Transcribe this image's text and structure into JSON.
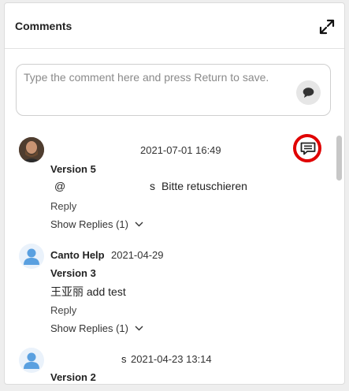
{
  "header": {
    "title": "Comments"
  },
  "composer": {
    "placeholder": "Type the comment here and press Return to save."
  },
  "comments": [
    {
      "date": "2021-07-01 16:49",
      "version": "Version 5",
      "mention_prefix": "@",
      "mention_suffix": "s",
      "text": "Bitte retuschieren",
      "reply_label": "Reply",
      "show_replies_label": "Show Replies (1)"
    },
    {
      "author": "Canto Help",
      "date": "2021-04-29",
      "version": "Version 3",
      "text": "王亚丽 add test",
      "reply_label": "Reply",
      "show_replies_label": "Show Replies (1)"
    },
    {
      "author_suffix": "s",
      "date": "2021-04-23 13:14",
      "version": "Version 2"
    }
  ],
  "colors": {
    "highlight": "#e00000"
  },
  "icons": [
    "expand-icon",
    "send-comment-icon",
    "reply-comment-icon",
    "chevron-down-icon",
    "user-avatar-icon"
  ]
}
